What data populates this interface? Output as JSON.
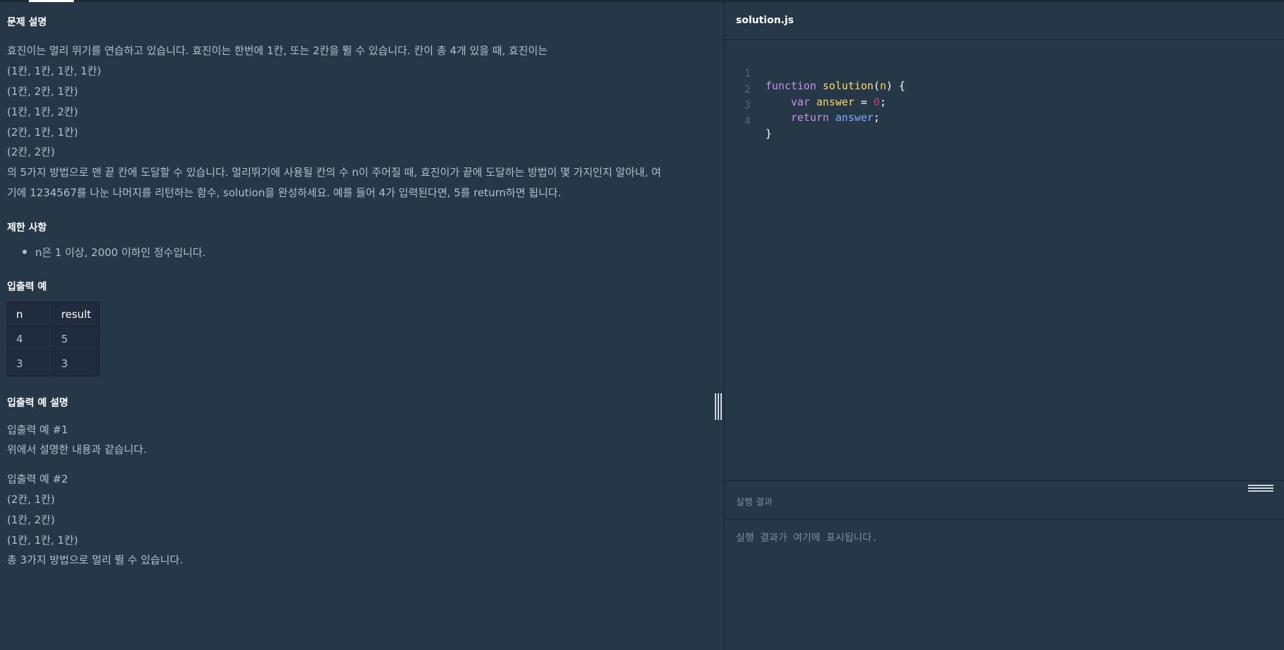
{
  "problem": {
    "description_title": "문제 설명",
    "description_lines": [
      "효진이는 멀리 뛰기를 연습하고 있습니다. 효진이는 한번에 1칸, 또는 2칸을 뛸 수 있습니다. 칸이 총 4개 있을 때, 효진이는",
      "(1칸, 1칸, 1칸, 1칸)",
      "(1칸, 2칸, 1칸)",
      "(1칸, 1칸, 2칸)",
      "(2칸, 1칸, 1칸)",
      "(2칸, 2칸)",
      "의 5가지 방법으로 맨 끝 칸에 도달할 수 있습니다. 멀리뛰기에 사용될 칸의 수 n이 주어질 때, 효진이가 끝에 도달하는 방법이 몇 가지인지 알아내, 여",
      "기에 1234567를 나눈 나머지를 리턴하는 함수, solution을 완성하세요. 예를 들어 4가 입력된다면, 5를 return하면 됩니다."
    ],
    "limits_title": "제한 사항",
    "limits": [
      "n은 1 이상, 2000 이하인 정수입니다."
    ],
    "io_title": "입출력 예",
    "io_table": {
      "headers": [
        "n",
        "result"
      ],
      "rows": [
        [
          "4",
          "5"
        ],
        [
          "3",
          "3"
        ]
      ]
    },
    "io_desc_title": "입출력 예 설명",
    "io_desc_lines": [
      "입출력 예 #1",
      "위에서 설명한 내용과 같습니다.",
      "입출력 예 #2",
      "(2칸, 1칸)",
      "(1칸, 2칸)",
      "(1칸, 1칸, 1칸)",
      "총 3가지 방법으로 멀리 뛸 수 있습니다."
    ]
  },
  "editor": {
    "filename": "solution.js",
    "line_numbers": [
      "1",
      "2",
      "3",
      "4"
    ],
    "code": {
      "l1": [
        "function",
        "solution",
        "n",
        "{"
      ],
      "l2": [
        "var",
        "answer",
        "=",
        "0",
        ";"
      ],
      "l3": [
        "return",
        "answer",
        ";"
      ],
      "l4": [
        "}"
      ]
    }
  },
  "result": {
    "label": "실행 결과",
    "placeholder": "실행 결과가 여기에 표시됩니다."
  }
}
